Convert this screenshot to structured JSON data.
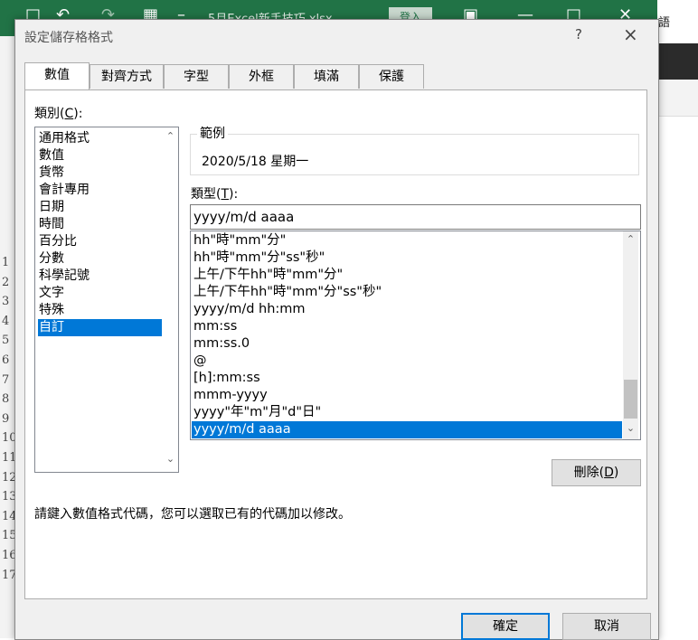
{
  "excel": {
    "title": "5月Excel新手技巧.xlsx",
    "login_label": "登入",
    "lang_label": "語",
    "row_numbers": [
      "1",
      "2",
      "3",
      "4",
      "5",
      "6",
      "7",
      "8",
      "9",
      "10",
      "11",
      "12",
      "13",
      "14",
      "15",
      "16",
      "17"
    ]
  },
  "dialog": {
    "title": "設定儲存格格式",
    "help_label": "?",
    "close_label": "×",
    "tabs": [
      {
        "label": "數值",
        "active": true
      },
      {
        "label": "對齊方式"
      },
      {
        "label": "字型"
      },
      {
        "label": "外框"
      },
      {
        "label": "填滿"
      },
      {
        "label": "保護"
      }
    ],
    "category": {
      "label": "類別(",
      "accel": "C",
      "label_end": "):",
      "items": [
        "通用格式",
        "數值",
        "貨幣",
        "會計專用",
        "日期",
        "時間",
        "百分比",
        "分數",
        "科學記號",
        "文字",
        "特殊",
        "自訂"
      ],
      "selected_index": 11
    },
    "sample": {
      "legend": "範例",
      "value": "2020/5/18 星期一"
    },
    "type": {
      "label": "類型(",
      "accel": "T",
      "label_end": "):",
      "value": "yyyy/m/d aaaa"
    },
    "formats": {
      "items": [
        "hh\"時\"mm\"分\"",
        "hh\"時\"mm\"分\"ss\"秒\"",
        "上午/下午hh\"時\"mm\"分\"",
        "上午/下午hh\"時\"mm\"分\"ss\"秒\"",
        "yyyy/m/d hh:mm",
        "mm:ss",
        "mm:ss.0",
        "@",
        "[h]:mm:ss",
        "mmm-yyyy",
        "yyyy\"年\"m\"月\"d\"日\"",
        "yyyy/m/d aaaa"
      ],
      "selected_index": 11
    },
    "delete_button": {
      "label": "刪除(",
      "accel": "D",
      "label_end": ")"
    },
    "hint": "請鍵入數值格式代碼，您可以選取已有的代碼加以修改。",
    "ok_label": "確定",
    "cancel_label": "取消"
  },
  "colors": {
    "excel_green": "#217346",
    "selection_blue": "#0078d7"
  }
}
